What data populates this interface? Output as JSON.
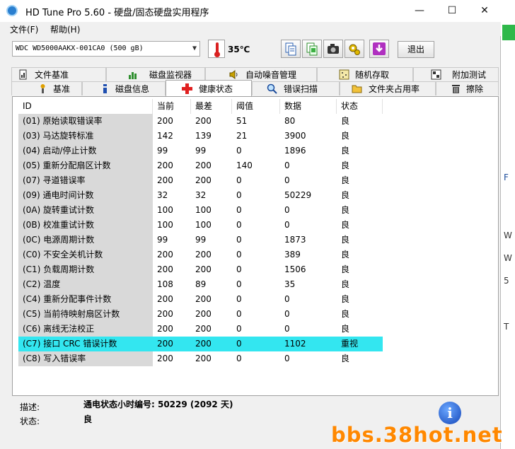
{
  "window": {
    "title": "HD Tune Pro 5.60 - 硬盘/固态硬盘实用程序",
    "minimize": "—",
    "maximize": "☐",
    "close": "✕"
  },
  "menu": [
    "文件(F)",
    "帮助(H)"
  ],
  "toolbar": {
    "drive": "WDC WD5000AAKX-001CA0 (500 gB)",
    "temperature": "35℃",
    "exit_label": "退出",
    "buttons": [
      "copy-text-icon",
      "copy-screenshot-icon",
      "camera-icon",
      "gear-icon",
      "download-icon"
    ]
  },
  "tabs_top": [
    {
      "label": "文件基准",
      "icon": "file-benchmark-icon"
    },
    {
      "label": "磁盘监视器",
      "icon": "disk-monitor-icon"
    },
    {
      "label": "自动噪音管理",
      "icon": "speaker-icon"
    },
    {
      "label": "随机存取",
      "icon": "random-access-icon"
    },
    {
      "label": "附加测试",
      "icon": "extra-tests-icon"
    }
  ],
  "tabs_bottom": [
    {
      "label": "基准",
      "icon": "benchmark-icon"
    },
    {
      "label": "磁盘信息",
      "icon": "info-icon"
    },
    {
      "label": "健康状态",
      "icon": "health-cross-icon"
    },
    {
      "label": "错误扫描",
      "icon": "magnifier-icon"
    },
    {
      "label": "文件夹占用率",
      "icon": "folder-icon"
    },
    {
      "label": "擦除",
      "icon": "trash-icon"
    }
  ],
  "health_table": {
    "headers": [
      "ID",
      "当前",
      "最差",
      "阈值",
      "数据",
      "状态"
    ],
    "rows": [
      [
        "(01) 原始读取错误率",
        "200",
        "200",
        "51",
        "80",
        "良"
      ],
      [
        "(03) 马达旋转标准",
        "142",
        "139",
        "21",
        "3900",
        "良"
      ],
      [
        "(04) 启动/停止计数",
        "99",
        "99",
        "0",
        "1896",
        "良"
      ],
      [
        "(05) 重新分配扇区计数",
        "200",
        "200",
        "140",
        "0",
        "良"
      ],
      [
        "(07) 寻道错误率",
        "200",
        "200",
        "0",
        "0",
        "良"
      ],
      [
        "(09) 通电时间计数",
        "32",
        "32",
        "0",
        "50229",
        "良"
      ],
      [
        "(0A) 旋转重试计数",
        "100",
        "100",
        "0",
        "0",
        "良"
      ],
      [
        "(0B) 校准重试计数",
        "100",
        "100",
        "0",
        "0",
        "良"
      ],
      [
        "(0C) 电源周期计数",
        "99",
        "99",
        "0",
        "1873",
        "良"
      ],
      [
        "(C0) 不安全关机计数",
        "200",
        "200",
        "0",
        "389",
        "良"
      ],
      [
        "(C1) 负载周期计数",
        "200",
        "200",
        "0",
        "1506",
        "良"
      ],
      [
        "(C2) 温度",
        "108",
        "89",
        "0",
        "35",
        "良"
      ],
      [
        "(C4) 重新分配事件计数",
        "200",
        "200",
        "0",
        "0",
        "良"
      ],
      [
        "(C5) 当前待映射扇区计数",
        "200",
        "200",
        "0",
        "0",
        "良"
      ],
      [
        "(C6) 离线无法校正",
        "200",
        "200",
        "0",
        "0",
        "良"
      ],
      [
        "(C7) 接口 CRC 错误计数",
        "200",
        "200",
        "0",
        "1102",
        "重视"
      ],
      [
        "(C8) 写入错误率",
        "200",
        "200",
        "0",
        "0",
        "良"
      ]
    ],
    "highlight_color": "#33e6f0"
  },
  "description": {
    "desc_label": "描述:",
    "desc_value": "通电状态小时编号: 50229 (2092 天)",
    "status_label": "状态:",
    "status_value": "良"
  },
  "watermark": "bbs.38hot.net",
  "background_glyphs": [
    "F",
    "W",
    "W",
    "5",
    "T"
  ]
}
